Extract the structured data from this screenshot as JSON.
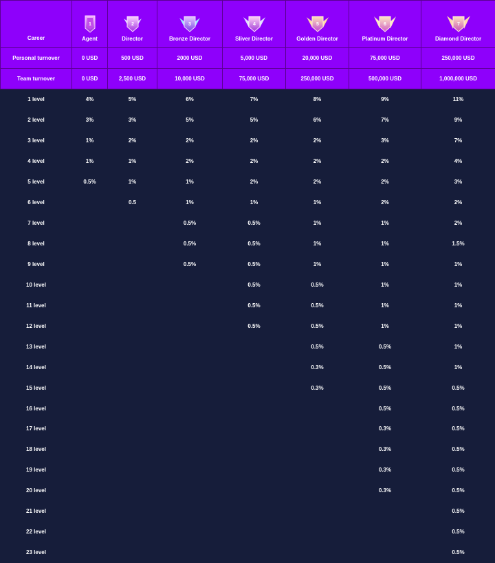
{
  "header": {
    "career_label": "Career",
    "ranks": [
      {
        "name": "Agent",
        "level": "1"
      },
      {
        "name": "Director",
        "level": "2"
      },
      {
        "name": "Bronze Director",
        "level": "3"
      },
      {
        "name": "Sliver Director",
        "level": "4"
      },
      {
        "name": "Golden Director",
        "level": "5"
      },
      {
        "name": "Platinum Director",
        "level": "6"
      },
      {
        "name": "Diamond Director",
        "level": "7"
      }
    ]
  },
  "summary": [
    {
      "label": "Personal turnover",
      "values": [
        "0 USD",
        "500 USD",
        "2000 USD",
        "5,000 USD",
        "20,000 USD",
        "75,000 USD",
        "250,000 USD"
      ]
    },
    {
      "label": "Team turnover",
      "values": [
        "0 USD",
        "2,500 USD",
        "10,000 USD",
        "75,000 USD",
        "250,000 USD",
        "500,000 USD",
        "1,000,000 USD"
      ]
    }
  ],
  "levels": [
    {
      "label": "1 level",
      "values": [
        "4%",
        "5%",
        "6%",
        "7%",
        "8%",
        "9%",
        "11%"
      ]
    },
    {
      "label": "2 level",
      "values": [
        "3%",
        "3%",
        "5%",
        "5%",
        "6%",
        "7%",
        "9%"
      ]
    },
    {
      "label": "3 level",
      "values": [
        "1%",
        "2%",
        "2%",
        "2%",
        "2%",
        "3%",
        "7%"
      ]
    },
    {
      "label": "4 level",
      "values": [
        "1%",
        "1%",
        "2%",
        "2%",
        "2%",
        "2%",
        "4%"
      ]
    },
    {
      "label": "5 level",
      "values": [
        "0.5%",
        "1%",
        "1%",
        "2%",
        "2%",
        "2%",
        "3%"
      ]
    },
    {
      "label": "6 level",
      "values": [
        "",
        "0.5",
        "1%",
        "1%",
        "1%",
        "2%",
        "2%"
      ]
    },
    {
      "label": "7 level",
      "values": [
        "",
        "",
        "0.5%",
        "0.5%",
        "1%",
        "1%",
        "2%"
      ]
    },
    {
      "label": "8 level",
      "values": [
        "",
        "",
        "0.5%",
        "0.5%",
        "1%",
        "1%",
        "1.5%"
      ]
    },
    {
      "label": "9 level",
      "values": [
        "",
        "",
        "0.5%",
        "0.5%",
        "1%",
        "1%",
        "1%"
      ]
    },
    {
      "label": "10 level",
      "values": [
        "",
        "",
        "",
        "0.5%",
        "0.5%",
        "1%",
        "1%"
      ]
    },
    {
      "label": "11 level",
      "values": [
        "",
        "",
        "",
        "0.5%",
        "0.5%",
        "1%",
        "1%"
      ]
    },
    {
      "label": "12 level",
      "values": [
        "",
        "",
        "",
        "0.5%",
        "0.5%",
        "1%",
        "1%"
      ]
    },
    {
      "label": "13 level",
      "values": [
        "",
        "",
        "",
        "",
        "0.5%",
        "0.5%",
        "1%"
      ]
    },
    {
      "label": "14 level",
      "values": [
        "",
        "",
        "",
        "",
        "0.3%",
        "0.5%",
        "1%"
      ]
    },
    {
      "label": "15 level",
      "values": [
        "",
        "",
        "",
        "",
        "0.3%",
        "0.5%",
        "0.5%"
      ]
    },
    {
      "label": "16 level",
      "values": [
        "",
        "",
        "",
        "",
        "",
        "0.5%",
        "0.5%"
      ]
    },
    {
      "label": "17 level",
      "values": [
        "",
        "",
        "",
        "",
        "",
        "0.3%",
        "0.5%"
      ]
    },
    {
      "label": "18 level",
      "values": [
        "",
        "",
        "",
        "",
        "",
        "0.3%",
        "0.5%"
      ]
    },
    {
      "label": "19 level",
      "values": [
        "",
        "",
        "",
        "",
        "",
        "0.3%",
        "0.5%"
      ]
    },
    {
      "label": "20 level",
      "values": [
        "",
        "",
        "",
        "",
        "",
        "0.3%",
        "0.5%"
      ]
    },
    {
      "label": "21 level",
      "values": [
        "",
        "",
        "",
        "",
        "",
        "",
        "0.5%"
      ]
    },
    {
      "label": "22 level",
      "values": [
        "",
        "",
        "",
        "",
        "",
        "",
        "0.5%"
      ]
    },
    {
      "label": "23 level",
      "values": [
        "",
        "",
        "",
        "",
        "",
        "",
        "0.5%"
      ]
    }
  ],
  "colors": {
    "header_bg": "#8e00fb",
    "body_bg": "#161d3a",
    "text": "#ffffff"
  },
  "icons": [
    "rank-1-badge-icon",
    "rank-2-badge-icon",
    "rank-3-badge-icon",
    "rank-4-badge-icon",
    "rank-5-badge-icon",
    "rank-6-badge-icon",
    "rank-7-badge-icon"
  ]
}
